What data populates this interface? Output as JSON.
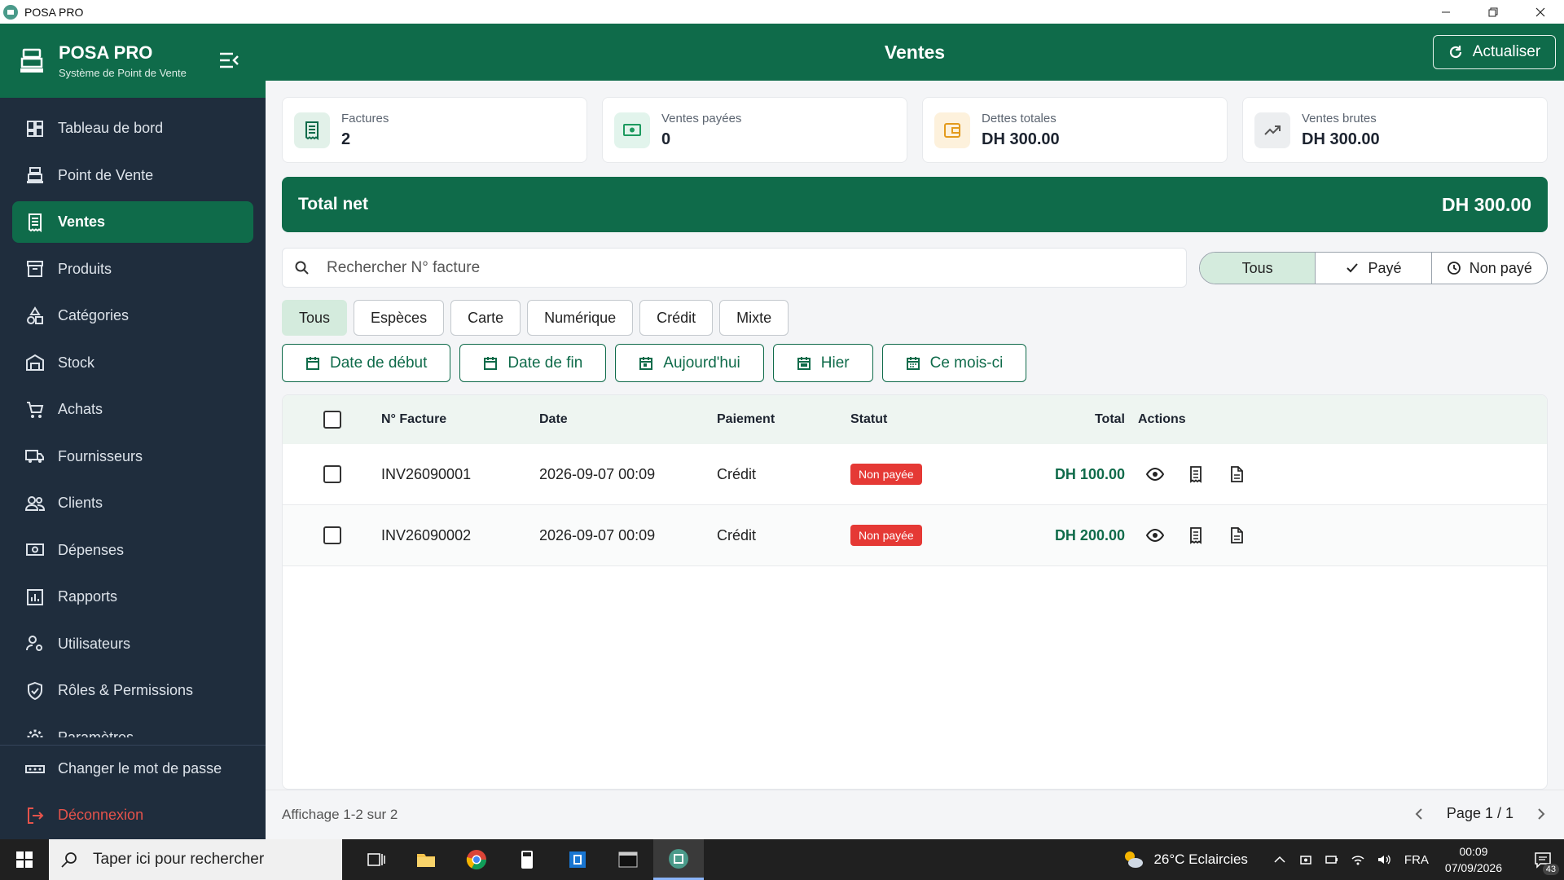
{
  "window": {
    "title": "POSA PRO"
  },
  "sidebar": {
    "brand_name": "POSA PRO",
    "brand_sub": "Système de Point de Vente",
    "items": [
      {
        "label": "Tableau de bord",
        "icon": "dashboard-icon"
      },
      {
        "label": "Point de Vente",
        "icon": "cash-register-icon"
      },
      {
        "label": "Ventes",
        "icon": "receipt-icon",
        "active": true
      },
      {
        "label": "Produits",
        "icon": "box-icon"
      },
      {
        "label": "Catégories",
        "icon": "categories-icon"
      },
      {
        "label": "Stock",
        "icon": "warehouse-icon"
      },
      {
        "label": "Achats",
        "icon": "cart-icon"
      },
      {
        "label": "Fournisseurs",
        "icon": "truck-icon"
      },
      {
        "label": "Clients",
        "icon": "users-icon"
      },
      {
        "label": "Dépenses",
        "icon": "money-icon"
      },
      {
        "label": "Rapports",
        "icon": "chart-icon"
      },
      {
        "label": "Utilisateurs",
        "icon": "user-cog-icon"
      },
      {
        "label": "Rôles & Permissions",
        "icon": "shield-icon"
      },
      {
        "label": "Paramètres",
        "icon": "gear-icon"
      }
    ],
    "change_password": "Changer le mot de passe",
    "logout": "Déconnexion"
  },
  "header": {
    "title": "Ventes",
    "refresh_label": "Actualiser"
  },
  "stats": [
    {
      "label": "Factures",
      "value": "2",
      "icon": "receipt-icon"
    },
    {
      "label": "Ventes payées",
      "value": "0",
      "icon": "cash-icon"
    },
    {
      "label": "Dettes totales",
      "value": "DH 300.00",
      "icon": "wallet-icon"
    },
    {
      "label": "Ventes brutes",
      "value": "DH 300.00",
      "icon": "trending-up-icon"
    }
  ],
  "total_net": {
    "label": "Total net",
    "value": "DH 300.00"
  },
  "search": {
    "placeholder": "Rechercher N° facture"
  },
  "status_filter": {
    "all": "Tous",
    "paid": "Payé",
    "unpaid": "Non payé"
  },
  "payment_filters": [
    "Tous",
    "Espèces",
    "Carte",
    "Numérique",
    "Crédit",
    "Mixte"
  ],
  "date_filters": [
    "Date de début",
    "Date de fin",
    "Aujourd'hui",
    "Hier",
    "Ce mois-ci"
  ],
  "table": {
    "headers": {
      "invoice": "N° Facture",
      "date": "Date",
      "payment": "Paiement",
      "status": "Statut",
      "total": "Total",
      "actions": "Actions"
    },
    "rows": [
      {
        "invoice": "INV26090001",
        "date": "2026-09-07 00:09",
        "payment": "Crédit",
        "status": "Non payée",
        "total": "DH 100.00"
      },
      {
        "invoice": "INV26090002",
        "date": "2026-09-07 00:09",
        "payment": "Crédit",
        "status": "Non payée",
        "total": "DH 200.00"
      }
    ]
  },
  "footer": {
    "info": "Affichage 1-2 sur 2",
    "page": "Page 1 / 1"
  },
  "taskbar": {
    "search_placeholder": "Taper ici pour rechercher",
    "weather": "26°C  Eclaircies",
    "lang": "FRA",
    "time": "00:09",
    "date": "07/09/2026",
    "notifications": "43"
  },
  "colors": {
    "primary": "#0f6b4a",
    "sidebar": "#1f2d3d",
    "danger": "#e53935",
    "active_chip": "#d4ebdd"
  }
}
